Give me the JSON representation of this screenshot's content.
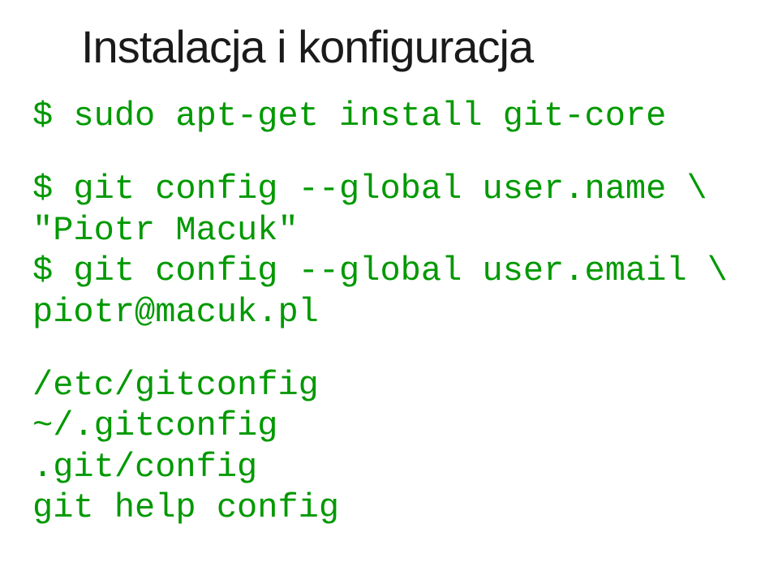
{
  "title": "Instalacja i konfiguracja",
  "block1": {
    "line1": "$ sudo apt-get install git-core"
  },
  "block2": {
    "line1": "$ git config --global user.name \\",
    "line2": "\"Piotr Macuk\"",
    "line3": "$ git config --global user.email \\",
    "line4": "piotr@macuk.pl"
  },
  "block3": {
    "line1": "/etc/gitconfig",
    "line2": "~/.gitconfig",
    "line3": ".git/config",
    "line4": "git help config"
  }
}
